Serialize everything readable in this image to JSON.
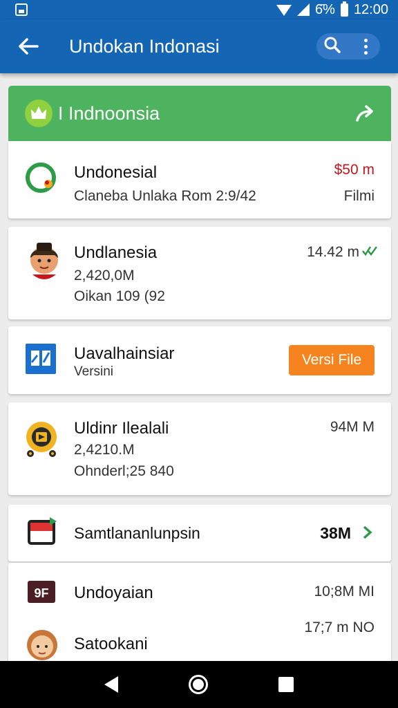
{
  "status_bar": {
    "battery_text": "6̄%",
    "time": "12:00"
  },
  "app_bar": {
    "title": "Undokan Indonasi"
  },
  "header_card": {
    "title": "I Indnoonsia"
  },
  "items": [
    {
      "title": "Undonesial",
      "subtitle": "Claneba Unlaka Rom 2:9/42",
      "size": "$50 m",
      "right_sub": "Filmi",
      "icon": "location-pin-icon"
    },
    {
      "title": "Undlanesia",
      "subtitle": "2,420,0M",
      "subtitle2": "Oikan 109 (92",
      "size": "14.42 m",
      "icon": "person-avatar-icon"
    },
    {
      "title": "Uavalhainsiar",
      "subtitle": "Versini",
      "button": "Versi File",
      "icon": "app-tile-icon"
    },
    {
      "title": "Uldinr Ilealali",
      "subtitle": "2,4210.M",
      "subtitle2": "Ohnderl;25 840",
      "size": "94M M",
      "icon": "film-reel-icon"
    },
    {
      "title": "Samtlananlunpsin",
      "size": "38M",
      "icon": "screen-flag-icon"
    },
    {
      "title": "Undoyaian",
      "size": "10;8M MI",
      "icon": "gf-tile-icon"
    },
    {
      "title": "Satookani",
      "size": "17;7 m NO",
      "icon": "woman-avatar-icon"
    }
  ],
  "colors": {
    "primary": "#1565b5",
    "header_green": "#4eb35f",
    "accent_orange": "#f5841f",
    "price_red": "#c4161c",
    "check_green": "#2e9b48"
  }
}
